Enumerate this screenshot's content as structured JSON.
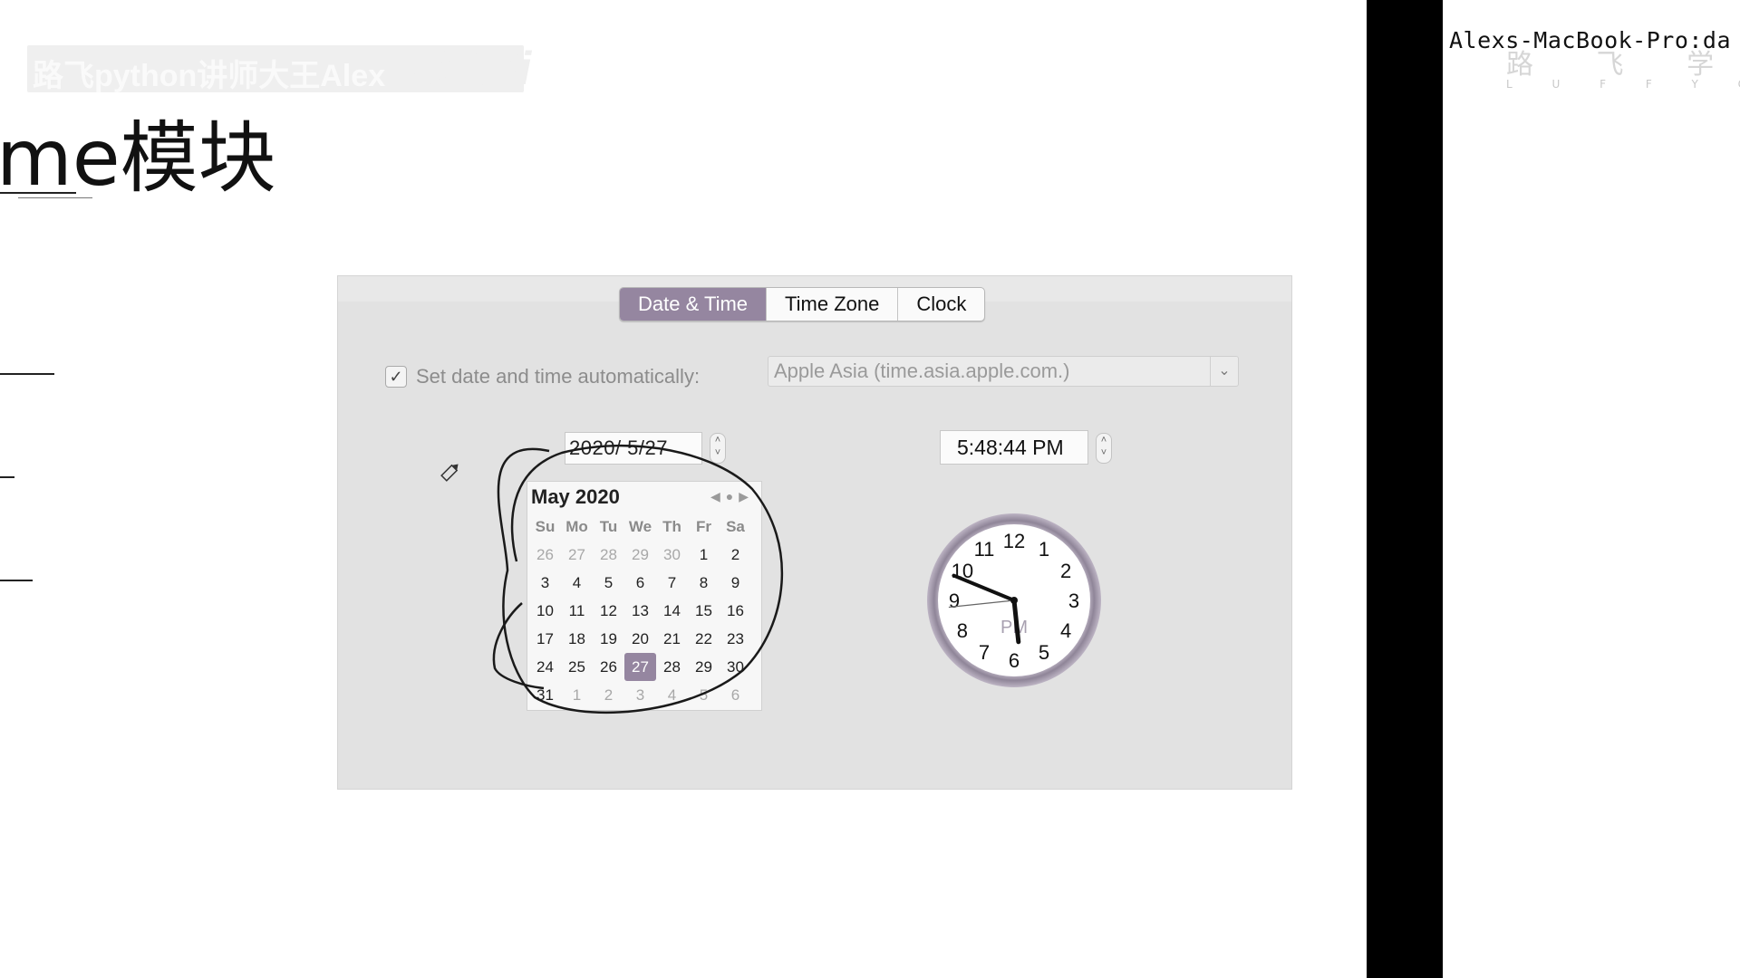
{
  "slide": {
    "title": "me模块",
    "watermark_text": "路飞python讲师大王Alex",
    "watermark_logo": "bilibili"
  },
  "terminal": {
    "prompt": "Alexs-MacBook-Pro:da",
    "brand_cn": "路 飞 学 城",
    "brand_en": "L U F F Y C I T Y"
  },
  "datetime_panel": {
    "tabs": [
      {
        "label": "Date & Time",
        "active": true
      },
      {
        "label": "Time Zone",
        "active": false
      },
      {
        "label": "Clock",
        "active": false
      }
    ],
    "auto_set_label": "Set date and time automatically:",
    "auto_set_checked": true,
    "checkmark_glyph": "✓",
    "time_server": "Apple Asia (time.asia.apple.com.)",
    "date_value": "2020/ 5/27",
    "time_value": "5:48:44 PM",
    "calendar": {
      "month_title": "May 2020",
      "nav_icons": [
        "prev-arrow-icon",
        "today-dot-icon",
        "next-arrow-icon"
      ],
      "weekdays": [
        "Su",
        "Mo",
        "Tu",
        "We",
        "Th",
        "Fr",
        "Sa"
      ],
      "weeks": [
        [
          "26",
          "27",
          "28",
          "29",
          "30",
          "1",
          "2"
        ],
        [
          "3",
          "4",
          "5",
          "6",
          "7",
          "8",
          "9"
        ],
        [
          "10",
          "11",
          "12",
          "13",
          "14",
          "15",
          "16"
        ],
        [
          "17",
          "18",
          "19",
          "20",
          "21",
          "22",
          "23"
        ],
        [
          "24",
          "25",
          "26",
          "27",
          "28",
          "29",
          "30"
        ],
        [
          "31",
          "1",
          "2",
          "3",
          "4",
          "5",
          "6"
        ]
      ],
      "selected_day": "27"
    },
    "clock": {
      "numerals": [
        "12",
        "1",
        "2",
        "3",
        "4",
        "5",
        "6",
        "7",
        "8",
        "9",
        "10",
        "11"
      ],
      "period": "PM",
      "hour": 5,
      "minute": 48,
      "second": 44
    }
  },
  "colors": {
    "accent": "#9586a0",
    "panel_bg": "#e2e2e2",
    "annotation": "#1a1a1a"
  }
}
